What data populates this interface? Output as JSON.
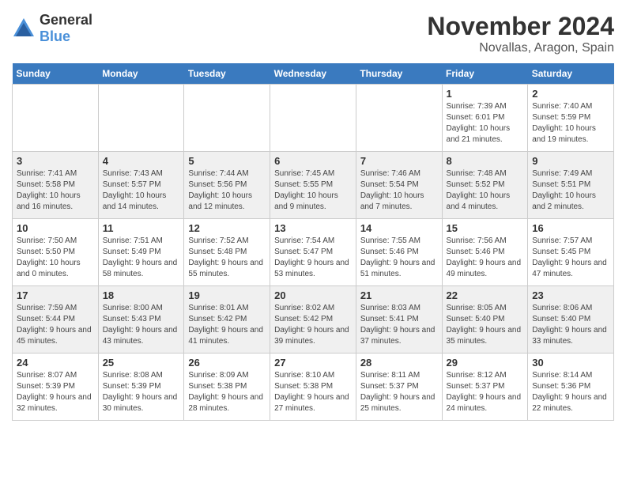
{
  "logo": {
    "general": "General",
    "blue": "Blue"
  },
  "title": "November 2024",
  "location": "Novallas, Aragon, Spain",
  "days_header": [
    "Sunday",
    "Monday",
    "Tuesday",
    "Wednesday",
    "Thursday",
    "Friday",
    "Saturday"
  ],
  "weeks": [
    {
      "days": [
        {
          "num": "",
          "info": ""
        },
        {
          "num": "",
          "info": ""
        },
        {
          "num": "",
          "info": ""
        },
        {
          "num": "",
          "info": ""
        },
        {
          "num": "",
          "info": ""
        },
        {
          "num": "1",
          "info": "Sunrise: 7:39 AM\nSunset: 6:01 PM\nDaylight: 10 hours and 21 minutes."
        },
        {
          "num": "2",
          "info": "Sunrise: 7:40 AM\nSunset: 5:59 PM\nDaylight: 10 hours and 19 minutes."
        }
      ]
    },
    {
      "days": [
        {
          "num": "3",
          "info": "Sunrise: 7:41 AM\nSunset: 5:58 PM\nDaylight: 10 hours and 16 minutes."
        },
        {
          "num": "4",
          "info": "Sunrise: 7:43 AM\nSunset: 5:57 PM\nDaylight: 10 hours and 14 minutes."
        },
        {
          "num": "5",
          "info": "Sunrise: 7:44 AM\nSunset: 5:56 PM\nDaylight: 10 hours and 12 minutes."
        },
        {
          "num": "6",
          "info": "Sunrise: 7:45 AM\nSunset: 5:55 PM\nDaylight: 10 hours and 9 minutes."
        },
        {
          "num": "7",
          "info": "Sunrise: 7:46 AM\nSunset: 5:54 PM\nDaylight: 10 hours and 7 minutes."
        },
        {
          "num": "8",
          "info": "Sunrise: 7:48 AM\nSunset: 5:52 PM\nDaylight: 10 hours and 4 minutes."
        },
        {
          "num": "9",
          "info": "Sunrise: 7:49 AM\nSunset: 5:51 PM\nDaylight: 10 hours and 2 minutes."
        }
      ]
    },
    {
      "days": [
        {
          "num": "10",
          "info": "Sunrise: 7:50 AM\nSunset: 5:50 PM\nDaylight: 10 hours and 0 minutes."
        },
        {
          "num": "11",
          "info": "Sunrise: 7:51 AM\nSunset: 5:49 PM\nDaylight: 9 hours and 58 minutes."
        },
        {
          "num": "12",
          "info": "Sunrise: 7:52 AM\nSunset: 5:48 PM\nDaylight: 9 hours and 55 minutes."
        },
        {
          "num": "13",
          "info": "Sunrise: 7:54 AM\nSunset: 5:47 PM\nDaylight: 9 hours and 53 minutes."
        },
        {
          "num": "14",
          "info": "Sunrise: 7:55 AM\nSunset: 5:46 PM\nDaylight: 9 hours and 51 minutes."
        },
        {
          "num": "15",
          "info": "Sunrise: 7:56 AM\nSunset: 5:46 PM\nDaylight: 9 hours and 49 minutes."
        },
        {
          "num": "16",
          "info": "Sunrise: 7:57 AM\nSunset: 5:45 PM\nDaylight: 9 hours and 47 minutes."
        }
      ]
    },
    {
      "days": [
        {
          "num": "17",
          "info": "Sunrise: 7:59 AM\nSunset: 5:44 PM\nDaylight: 9 hours and 45 minutes."
        },
        {
          "num": "18",
          "info": "Sunrise: 8:00 AM\nSunset: 5:43 PM\nDaylight: 9 hours and 43 minutes."
        },
        {
          "num": "19",
          "info": "Sunrise: 8:01 AM\nSunset: 5:42 PM\nDaylight: 9 hours and 41 minutes."
        },
        {
          "num": "20",
          "info": "Sunrise: 8:02 AM\nSunset: 5:42 PM\nDaylight: 9 hours and 39 minutes."
        },
        {
          "num": "21",
          "info": "Sunrise: 8:03 AM\nSunset: 5:41 PM\nDaylight: 9 hours and 37 minutes."
        },
        {
          "num": "22",
          "info": "Sunrise: 8:05 AM\nSunset: 5:40 PM\nDaylight: 9 hours and 35 minutes."
        },
        {
          "num": "23",
          "info": "Sunrise: 8:06 AM\nSunset: 5:40 PM\nDaylight: 9 hours and 33 minutes."
        }
      ]
    },
    {
      "days": [
        {
          "num": "24",
          "info": "Sunrise: 8:07 AM\nSunset: 5:39 PM\nDaylight: 9 hours and 32 minutes."
        },
        {
          "num": "25",
          "info": "Sunrise: 8:08 AM\nSunset: 5:39 PM\nDaylight: 9 hours and 30 minutes."
        },
        {
          "num": "26",
          "info": "Sunrise: 8:09 AM\nSunset: 5:38 PM\nDaylight: 9 hours and 28 minutes."
        },
        {
          "num": "27",
          "info": "Sunrise: 8:10 AM\nSunset: 5:38 PM\nDaylight: 9 hours and 27 minutes."
        },
        {
          "num": "28",
          "info": "Sunrise: 8:11 AM\nSunset: 5:37 PM\nDaylight: 9 hours and 25 minutes."
        },
        {
          "num": "29",
          "info": "Sunrise: 8:12 AM\nSunset: 5:37 PM\nDaylight: 9 hours and 24 minutes."
        },
        {
          "num": "30",
          "info": "Sunrise: 8:14 AM\nSunset: 5:36 PM\nDaylight: 9 hours and 22 minutes."
        }
      ]
    }
  ]
}
